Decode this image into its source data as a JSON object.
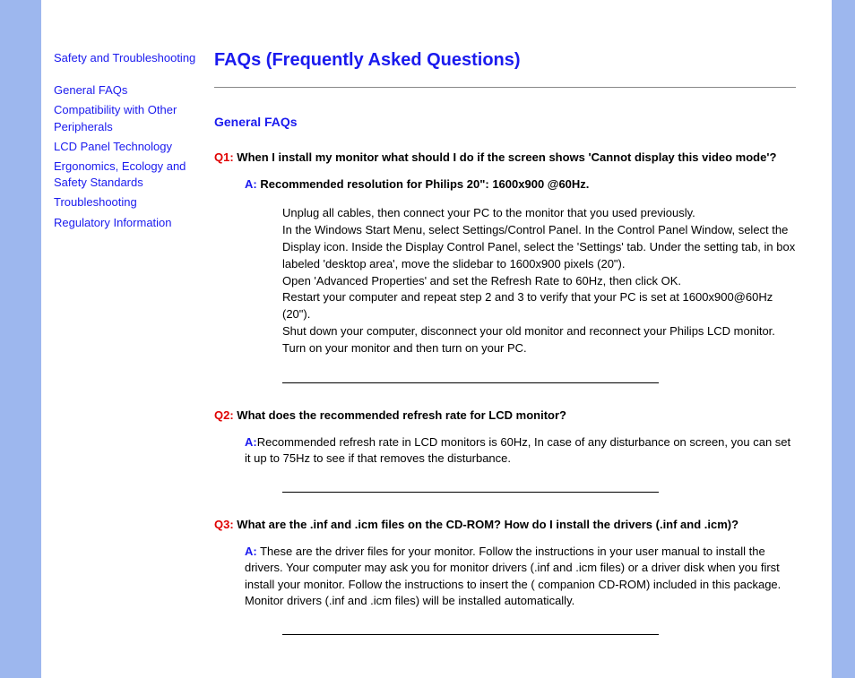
{
  "sidebar": {
    "top_link": "Safety and Troubleshooting",
    "links": [
      "General FAQs",
      "Compatibility with Other Peripherals",
      "LCD Panel Technology",
      "Ergonomics, Ecology and Safety Standards",
      "Troubleshooting",
      "Regulatory Information"
    ]
  },
  "page": {
    "title": "FAQs (Frequently Asked Questions)",
    "section_title": "General FAQs"
  },
  "faq": {
    "q1": {
      "label": "Q1:",
      "text": "When I install my monitor what should I do if the screen shows 'Cannot display this video mode'?",
      "a_label": "A:",
      "a_text": "Recommended resolution for Philips 20\": 1600x900 @60Hz.",
      "steps": [
        "Unplug all cables, then connect your PC to the monitor that you used previously.",
        "In the Windows Start Menu, select Settings/Control Panel. In the Control Panel Window, select the Display icon. Inside the Display Control Panel, select the 'Settings' tab. Under the setting tab, in box labeled 'desktop area', move the slidebar to 1600x900 pixels (20\").",
        "Open 'Advanced Properties' and set the Refresh Rate to 60Hz, then click OK.",
        "Restart your computer and repeat step 2 and 3 to verify that your PC is set at 1600x900@60Hz (20\").",
        "Shut down your computer, disconnect your old monitor and reconnect your Philips LCD monitor.",
        "Turn on your monitor and then turn on your PC."
      ]
    },
    "q2": {
      "label": "Q2:",
      "text": "What does the recommended refresh rate for LCD monitor?",
      "a_label": "A:",
      "a_text": "Recommended refresh rate in LCD monitors is 60Hz, In case of any disturbance on screen, you can set it up to 75Hz to see if that removes the disturbance."
    },
    "q3": {
      "label": "Q3:",
      "text": "What are the .inf and .icm files on the CD-ROM? How do I install the drivers (.inf and .icm)?",
      "a_label": "A:",
      "a_text": "These are the driver files for your monitor. Follow the instructions in your user manual to install the drivers. Your computer may ask you for monitor drivers (.inf and .icm files) or a driver disk when you first install your monitor. Follow the instructions to insert the ( companion CD-ROM) included in this package. Monitor drivers (.inf and .icm files) will be installed automatically."
    }
  }
}
